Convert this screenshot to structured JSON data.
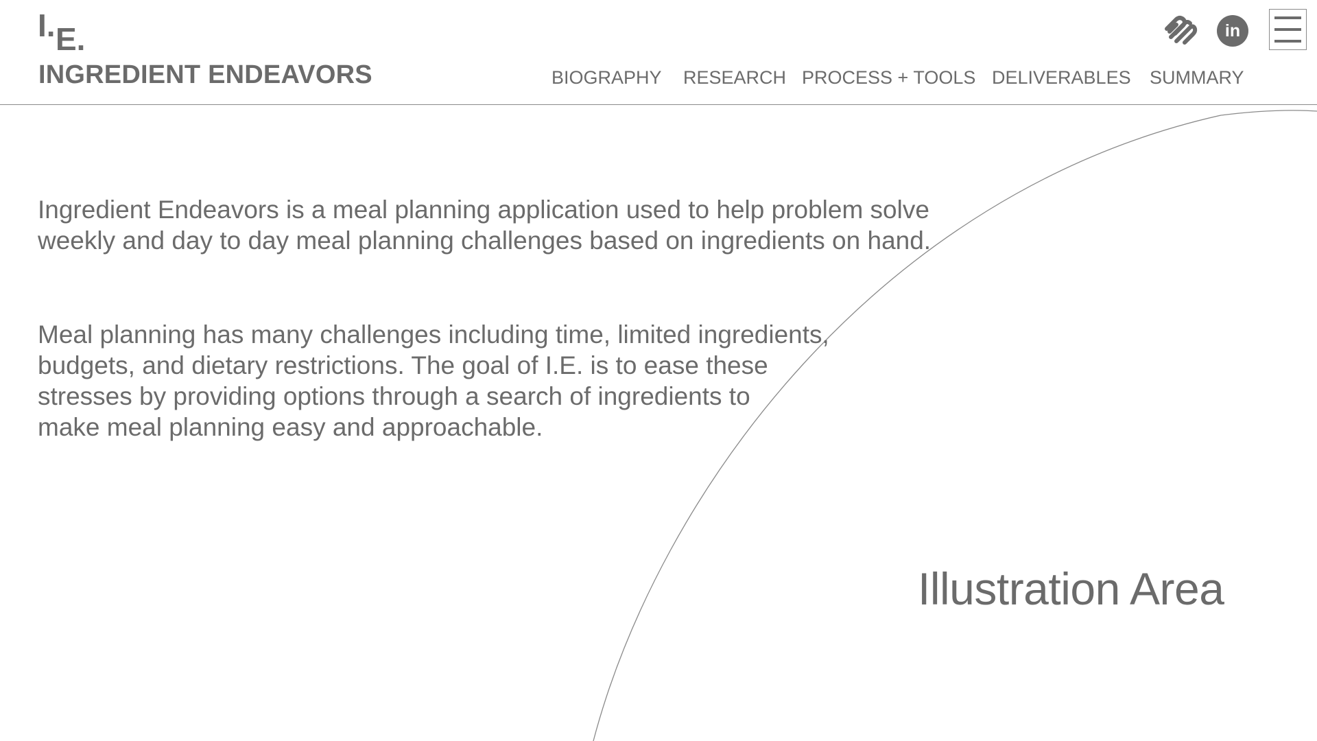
{
  "brand": {
    "mark_first": "I.",
    "mark_second": "E.",
    "name": "INGREDIENT ENDEAVORS"
  },
  "nav": {
    "items": [
      {
        "label": "BIOGRAPHY"
      },
      {
        "label": "RESEARCH"
      },
      {
        "label": "PROCESS + TOOLS"
      },
      {
        "label": "DELIVERABLES"
      },
      {
        "label": "SUMMARY"
      }
    ]
  },
  "social": {
    "icons": [
      "squarespace-icon",
      "linkedin-icon",
      "hamburger-menu-icon"
    ],
    "linkedin_glyph": "in"
  },
  "content": {
    "intro_lines": [
      "Ingredient Endeavors is a meal planning application used to help problem solve",
      "weekly and day to day meal planning challenges based on ingredients on hand."
    ],
    "goal_lines": [
      "Meal planning has many challenges including time, limited ingredients,",
      "budgets, and dietary restrictions. The goal of I.E. is to ease these",
      "stresses by providing options through a search of ingredients to",
      "make meal planning easy and approachable."
    ]
  },
  "illustration": {
    "label": "Illustration Area"
  },
  "colors": {
    "text": "#6b6b6b",
    "rule": "#8a8a8a",
    "background": "#ffffff"
  }
}
